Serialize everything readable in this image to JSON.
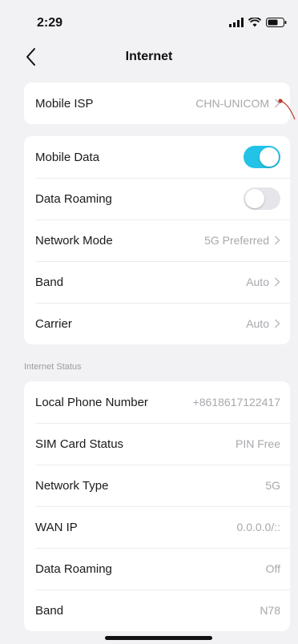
{
  "status_bar": {
    "time": "2:29"
  },
  "header": {
    "title": "Internet"
  },
  "isp": {
    "label": "Mobile ISP",
    "value": "CHN-UNICOM"
  },
  "settings": {
    "mobile_data": {
      "label": "Mobile Data",
      "enabled": true
    },
    "data_roaming": {
      "label": "Data Roaming",
      "enabled": false
    },
    "network_mode": {
      "label": "Network Mode",
      "value": "5G Preferred"
    },
    "band": {
      "label": "Band",
      "value": "Auto"
    },
    "carrier": {
      "label": "Carrier",
      "value": "Auto"
    }
  },
  "internet_status": {
    "section_title": "Internet Status",
    "rows": [
      {
        "label": "Local Phone Number",
        "value": "+8618617122417"
      },
      {
        "label": "SIM Card Status",
        "value": "PIN Free"
      },
      {
        "label": "Network Type",
        "value": "5G"
      },
      {
        "label": "WAN IP",
        "value": "0.0.0.0/::"
      },
      {
        "label": "Data Roaming",
        "value": "Off"
      },
      {
        "label": "Band",
        "value": "N78"
      }
    ]
  },
  "colors": {
    "accent": "#22c3e6",
    "background": "#f2f2f4",
    "annotation": "#c0392b"
  }
}
